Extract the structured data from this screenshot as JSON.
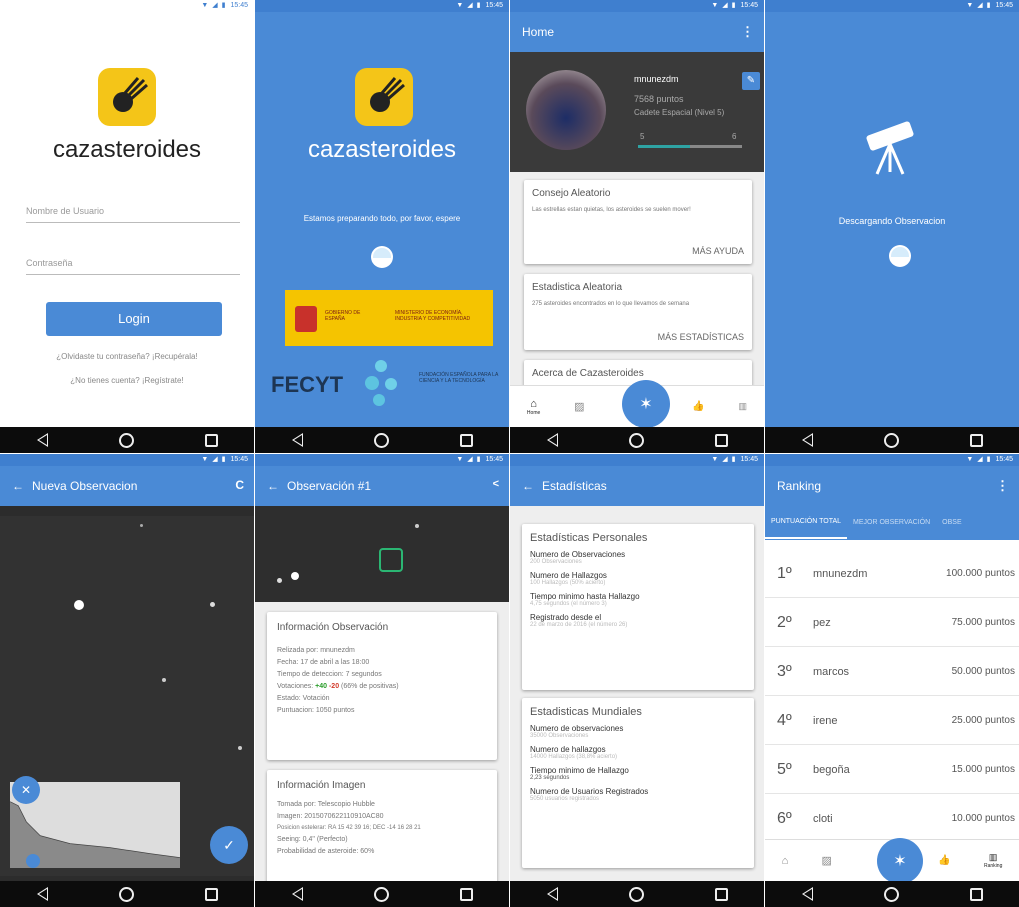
{
  "status_time": "15:45",
  "status_icons": "▼ ◢ ▮",
  "login": {
    "brand": "cazasteroides",
    "username_placeholder": "Nombre de Usuario",
    "password_placeholder": "Contraseña",
    "login_button": "Login",
    "forgot_link": "¿Olvidaste tu contraseña? ¡Recupérala!",
    "register_link": "¿No tienes cuenta? ¡Regístrate!"
  },
  "loading": {
    "brand": "cazasteroides",
    "message": "Estamos preparando todo, por favor, espere",
    "gov_text_1": "GOBIERNO DE ESPAÑA",
    "gov_text_2": "MINISTERIO DE ECONOMÍA, INDUSTRIA Y COMPETITIVIDAD",
    "fecyt": "FECYT",
    "fecyt_sub": "FUNDACIÓN ESPAÑOLA PARA LA CIENCIA Y LA TECNOLOGÍA"
  },
  "home": {
    "title": "Home",
    "username": "mnunezdm",
    "points": "7568 puntos",
    "rank": "Cadete Espacial (Nivel 5)",
    "level_from": "5",
    "level_to": "6",
    "level_progress": 0.5,
    "card1_title": "Consejo Aleatorio",
    "card1_text": "Las estrellas estan quietas, los asteroides se suelen mover!",
    "card1_link": "MÁS AYUDA",
    "card2_title": "Estadistica Aleatoria",
    "card2_text": "275 asteroides encontrados en lo que llevamos de semana",
    "card2_link": "MÁS ESTADÍSTICAS",
    "card3_title": "Acerca de Cazasteroides",
    "nav_home": "Home",
    "nav_ranking": "Ranking"
  },
  "download": {
    "message": "Descargando Observacion"
  },
  "new_obs": {
    "title": "Nueva Observacion",
    "refresh_icon": "C"
  },
  "obs1": {
    "title": "Observación #1",
    "info_title": "Información Observación",
    "info_lines": [
      "Relizada por: mnunezdm",
      "Fecha: 17 de abril a las 18:00",
      "Tiempo de deteccion: 7 segundos",
      "Estado: Votación",
      "Puntuacion: 1050 puntos"
    ],
    "votes_prefix": "Votaciones: ",
    "votes_pos": "+40",
    "votes_neg": "-20",
    "votes_suffix": " (66% de positivas)",
    "img_title": "Información Imagen",
    "img_lines": [
      "Tomada por: Telescopio Hubble",
      "Imagen: 2015070622110910AC80",
      "Posicion estelerar: RA 15 42 39 16; DEC -14 16 28 21",
      "Seeing: 0,4\" (Perfecto)",
      "Probabilidad de asteroide: 60%"
    ]
  },
  "stats": {
    "title": "Estadísticas",
    "personal_title": "Estadísticas Personales",
    "personal": [
      {
        "label": "Numero de Observaciones",
        "value": "200 Observaciones"
      },
      {
        "label": "Numero de Hallazgos",
        "value": "100 Hallazgos (50% acierto)"
      },
      {
        "label": "Tiempo minimo hasta Hallazgo",
        "value": "4,75 segundos (el número 3)"
      },
      {
        "label": "Registrado desde el",
        "value": "22 de marzo de 2016 (el número 26)"
      }
    ],
    "world_title": "Estadisticas Mundiales",
    "world": [
      {
        "label": "Numero de observaciones",
        "value": "35000 Observaciones"
      },
      {
        "label": "Numero de hallazgos",
        "value": "14000 Hallazgos (38,8% acierto)"
      },
      {
        "label": "Tiempo minimo de Hallazgo",
        "value": "2,23 segundos"
      },
      {
        "label": "Numero de Usuarios Registrados",
        "value": "5050 usuarios registrados"
      }
    ]
  },
  "ranking": {
    "title": "Ranking",
    "tabs": [
      "PUNTUACIÓN TOTAL",
      "MEJOR OBSERVACIÓN",
      "OBSE"
    ],
    "rows": [
      {
        "pos": "1º",
        "name": "mnunezdm",
        "points": "100.000 puntos"
      },
      {
        "pos": "2º",
        "name": "pez",
        "points": "75.000 puntos"
      },
      {
        "pos": "3º",
        "name": "marcos",
        "points": "50.000 puntos"
      },
      {
        "pos": "4º",
        "name": "irene",
        "points": "25.000 puntos"
      },
      {
        "pos": "5º",
        "name": "begoña",
        "points": "15.000 puntos"
      },
      {
        "pos": "6º",
        "name": "cloti",
        "points": "10.000 puntos"
      }
    ],
    "nav_ranking": "Ranking"
  }
}
